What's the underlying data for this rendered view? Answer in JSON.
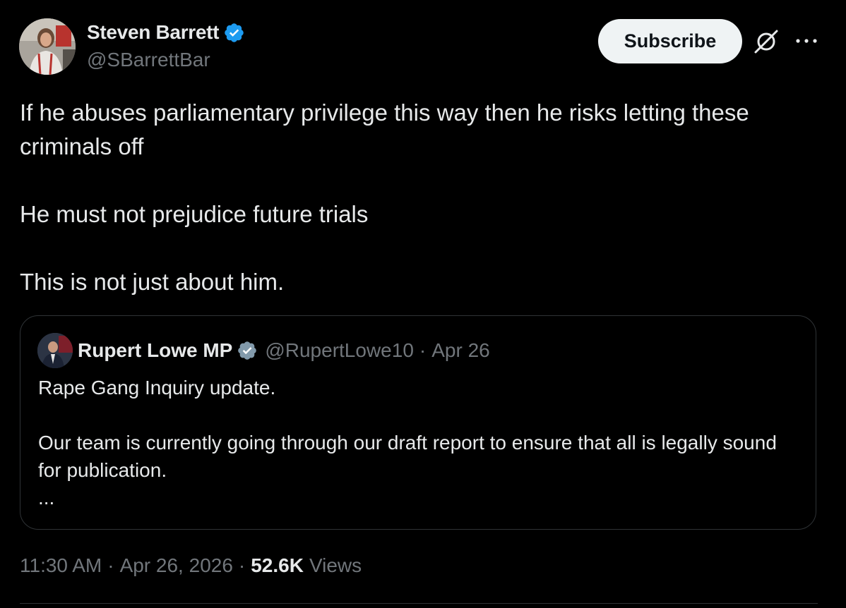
{
  "author": {
    "display_name": "Steven Barrett",
    "handle": "@SBarrettBar",
    "verified": true
  },
  "actions": {
    "subscribe_label": "Subscribe",
    "grok_icon": "grok-icon",
    "more_icon": "more-icon"
  },
  "tweet": {
    "paragraphs": [
      "If he abuses parliamentary privilege this way then he risks letting these criminals off",
      "He must not prejudice future trials",
      "This is not just about him."
    ]
  },
  "quote": {
    "display_name": "Rupert Lowe MP",
    "handle": "@RupertLowe10",
    "separator": "·",
    "date": "Apr 26",
    "paragraphs": [
      "Rape Gang Inquiry update.",
      "Our team is currently going through our draft report to ensure that all is legally sound for publication.",
      "..."
    ]
  },
  "meta": {
    "time": "11:30 AM",
    "separator": "·",
    "date": "Apr 26, 2026",
    "views_count": "52.6K",
    "views_label": "Views"
  },
  "colors": {
    "background": "#000000",
    "text_primary": "#e7e9ea",
    "text_secondary": "#71767b",
    "verified_blue": "#1d9bf0",
    "verified_gray": "#829aab",
    "border": "#2f3336"
  }
}
